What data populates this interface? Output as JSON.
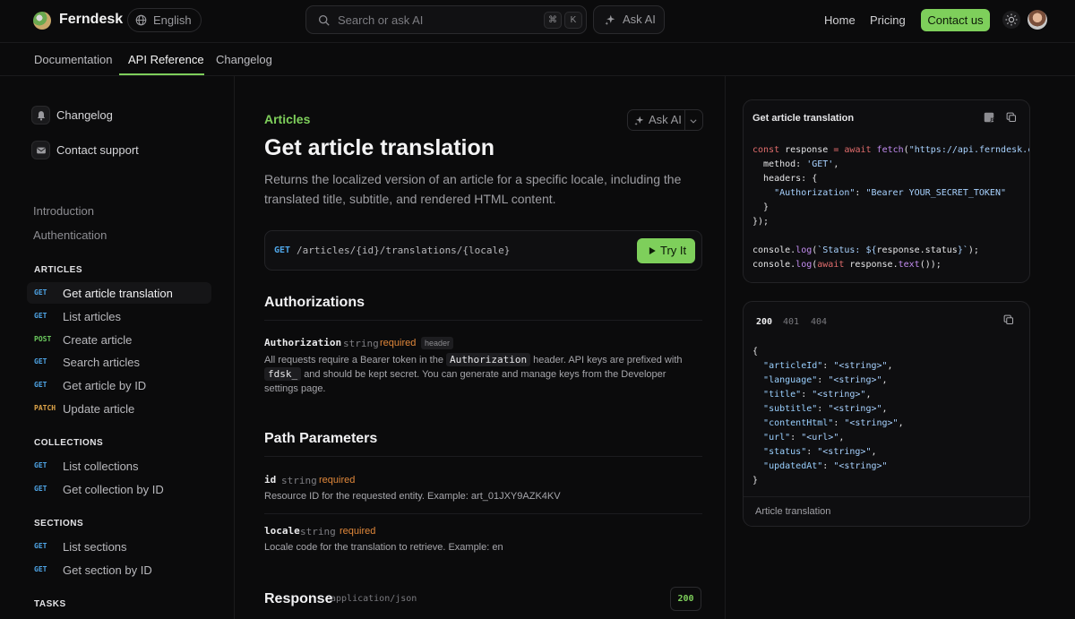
{
  "header": {
    "brand": "Ferndesk",
    "language": "English",
    "search_placeholder": "Search or ask AI",
    "kbd_cmd": "⌘",
    "kbd_k": "K",
    "ask_ai": "Ask AI",
    "nav_home": "Home",
    "nav_pricing": "Pricing",
    "contact": "Contact us"
  },
  "tabs": [
    "Documentation",
    "API Reference",
    "Changelog"
  ],
  "sidebar": {
    "links": [
      {
        "label": "Changelog",
        "icon": "bell-icon"
      },
      {
        "label": "Contact support",
        "icon": "mail-icon"
      }
    ],
    "plain": [
      "Introduction",
      "Authentication"
    ],
    "groups": [
      {
        "title": "ARTICLES",
        "items": [
          {
            "method": "GET",
            "label": "Get article translation"
          },
          {
            "method": "GET",
            "label": "List articles"
          },
          {
            "method": "POST",
            "label": "Create article"
          },
          {
            "method": "GET",
            "label": "Search articles"
          },
          {
            "method": "GET",
            "label": "Get article by ID"
          },
          {
            "method": "PATCH",
            "label": "Update article"
          }
        ]
      },
      {
        "title": "COLLECTIONS",
        "items": [
          {
            "method": "GET",
            "label": "List collections"
          },
          {
            "method": "GET",
            "label": "Get collection by ID"
          }
        ]
      },
      {
        "title": "SECTIONS",
        "items": [
          {
            "method": "GET",
            "label": "List sections"
          },
          {
            "method": "GET",
            "label": "Get section by ID"
          }
        ]
      },
      {
        "title": "TASKS",
        "items": []
      }
    ]
  },
  "main": {
    "eyebrow": "Articles",
    "ask_ai": "Ask AI",
    "title": "Get article translation",
    "description": "Returns the localized version of an article for a specific locale, including the translated title, subtitle, and rendered HTML content.",
    "endpoint": {
      "method": "GET",
      "path": "/articles/{id}/translations/{locale}",
      "try_label": "Try It"
    },
    "authorizations": {
      "heading": "Authorizations",
      "name": "Authorization",
      "type": "string",
      "required": "required",
      "location": "header",
      "desc_1": "All requests require a Bearer token in the",
      "desc_code_1": "Authorization",
      "desc_2": "header. API keys are prefixed with",
      "desc_code_2": "fdsk_",
      "desc_3": "and should be kept secret. You can generate and manage keys from the Developer settings page."
    },
    "path_params": {
      "heading": "Path Parameters",
      "params": [
        {
          "name": "id",
          "type": "string",
          "required": "required",
          "desc": "Resource ID for the requested entity. Example: art_01JXY9AZK4KV"
        },
        {
          "name": "locale",
          "type": "string",
          "required": "required",
          "desc": "Locale code for the translation to retrieve. Example: en"
        }
      ]
    },
    "response": {
      "heading": "Response",
      "content_type": "application/json",
      "status": "200"
    }
  },
  "request_card": {
    "title": "Get article translation",
    "url": "https://api.ferndesk.com",
    "method_value": "'GET'",
    "auth_key": "\"Authorization\"",
    "auth_value": "\"Bearer YOUR_SECRET_TOKEN\""
  },
  "response_card": {
    "tabs": [
      "200",
      "401",
      "404"
    ],
    "fields": [
      {
        "key": "\"articleId\"",
        "value": "\"<string>\""
      },
      {
        "key": "\"language\"",
        "value": "\"<string>\""
      },
      {
        "key": "\"title\"",
        "value": "\"<string>\""
      },
      {
        "key": "\"subtitle\"",
        "value": "\"<string>\""
      },
      {
        "key": "\"contentHtml\"",
        "value": "\"<string>\""
      },
      {
        "key": "\"url\"",
        "value": "\"<url>\""
      },
      {
        "key": "\"status\"",
        "value": "\"<string>\""
      },
      {
        "key": "\"updatedAt\"",
        "value": "\"<string>\""
      }
    ],
    "footer": "Article translation"
  },
  "colors": {
    "accent": "#7ecf5b",
    "get": "#4fa6e8",
    "post": "#6ccb5f",
    "patch": "#e0a64a",
    "required": "#e0873a"
  }
}
